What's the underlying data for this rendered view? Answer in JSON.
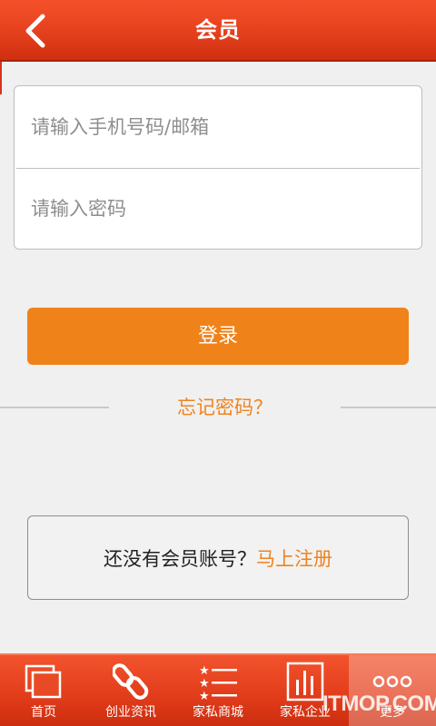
{
  "header": {
    "title": "会员",
    "back_icon": "chevron-left-icon"
  },
  "login": {
    "phone_placeholder": "请输入手机号码/邮箱",
    "password_placeholder": "请输入密码",
    "login_label": "登录",
    "forgot_label": "忘记密码？"
  },
  "register": {
    "prompt": "还没有会员账号？",
    "link": "马上注册"
  },
  "tabbar": {
    "items": [
      {
        "label": "首页",
        "icon": "pages-icon"
      },
      {
        "label": "创业资讯",
        "icon": "link-icon"
      },
      {
        "label": "家私商城",
        "icon": "star-list-icon"
      },
      {
        "label": "家私企业",
        "icon": "bar-chart-icon"
      },
      {
        "label": "更多",
        "icon": "more-dots-icon",
        "active": true
      }
    ]
  },
  "watermark": "ITMOP.COM",
  "colors": {
    "header": "#e4401d",
    "accent": "#f0821a",
    "link": "#ef8320",
    "background": "#f0f0f0"
  }
}
